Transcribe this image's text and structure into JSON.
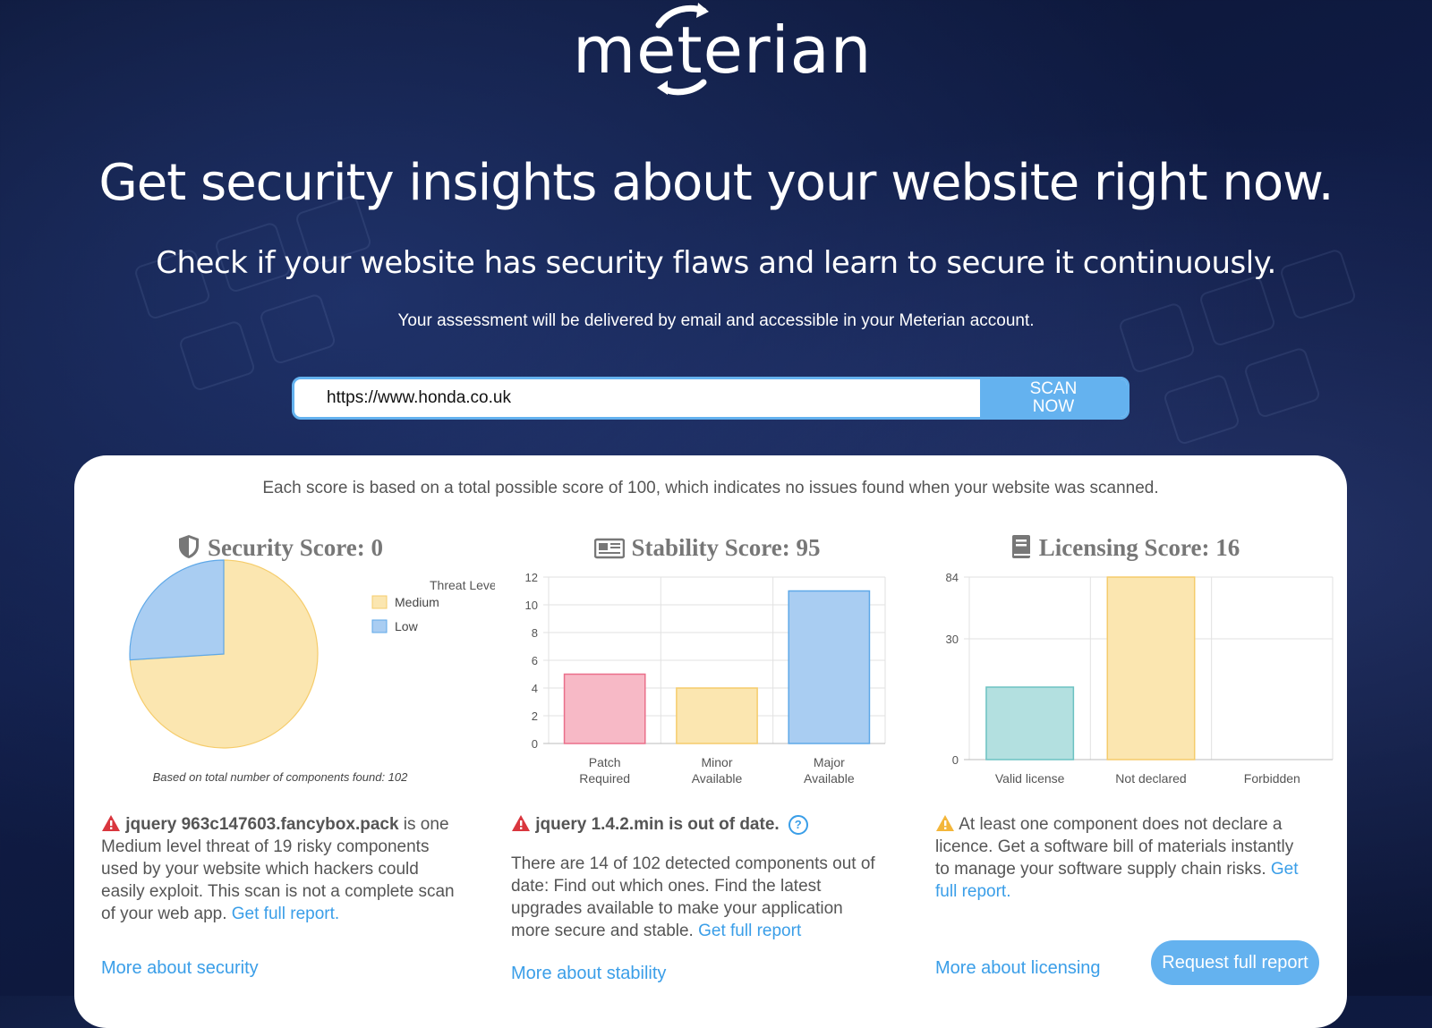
{
  "brand": {
    "logo_text": "meterian"
  },
  "hero": {
    "headline": "Get security insights about your website right now.",
    "subheadline": "Check if your website has security flaws and learn to secure it continuously.",
    "note": "Your assessment will be delivered by email and accessible in your Meterian account."
  },
  "scan": {
    "url_value": "https://www.honda.co.uk",
    "button_label": "SCAN\nNOW"
  },
  "results": {
    "intro": "Each score is based on a total possible score of 100, which indicates no issues found when your website was scanned.",
    "security": {
      "title": "Security Score: 0",
      "icon": "shield-icon",
      "legend_title": "Threat Level",
      "caption": "Based on total number of components found: 102",
      "warning_bold": "jquery 963c147603.fancybox.pack",
      "warning_text": " is one Medium level threat of 19 risky components used by your website which hackers could easily exploit. This scan is not a complete scan of your web app. ",
      "link": "Get full report.",
      "more": "More about security"
    },
    "stability": {
      "title": "Stability Score: 95",
      "icon": "newspaper-icon",
      "warning_bold": "jquery 1.4.2.min is out of date.",
      "body": "There are 14 of 102 detected components out of date: Find out which ones. Find the latest upgrades available to make your application more secure and stable. ",
      "link": "Get full report",
      "more": "More about stability"
    },
    "licensing": {
      "title": "Licensing Score: 16",
      "icon": "book-icon",
      "warning_text": "At least one component does not declare a licence. Get a software bill of materials instantly to manage your software supply chain risks. ",
      "link": "Get full report.",
      "more": "More about licensing"
    },
    "request_button": "Request full report"
  },
  "colors": {
    "medium_fill": "#fbe6b0",
    "medium_stroke": "#f5cc6b",
    "low_fill": "#a9cdf2",
    "low_stroke": "#5ea8e8",
    "red_fill": "#f7b9c6",
    "red_stroke": "#ea6f8a",
    "teal_fill": "#b3e0e0",
    "teal_stroke": "#6cc2c2",
    "accent": "#64b2ef",
    "link": "#3a9ee8"
  },
  "chart_data": [
    {
      "type": "pie",
      "categories": [
        "Medium",
        "Low"
      ],
      "values": [
        74,
        26
      ],
      "legend_title": "Threat Level",
      "legend_position": "right"
    },
    {
      "type": "bar",
      "categories": [
        "Patch\nRequired",
        "Minor\nAvailable",
        "Major\nAvailable"
      ],
      "values": [
        5,
        4,
        11
      ],
      "ylim": [
        0,
        12
      ],
      "yticks": [
        0,
        2,
        4,
        6,
        8,
        10,
        12
      ],
      "grid": true
    },
    {
      "type": "bar",
      "categories": [
        "Valid license",
        "Not declared",
        "Forbidden"
      ],
      "values": [
        18,
        84,
        0
      ],
      "yticks": [
        0,
        30,
        84
      ],
      "grid": true,
      "scale": "nonlinear axis labels 0/30/84"
    }
  ]
}
